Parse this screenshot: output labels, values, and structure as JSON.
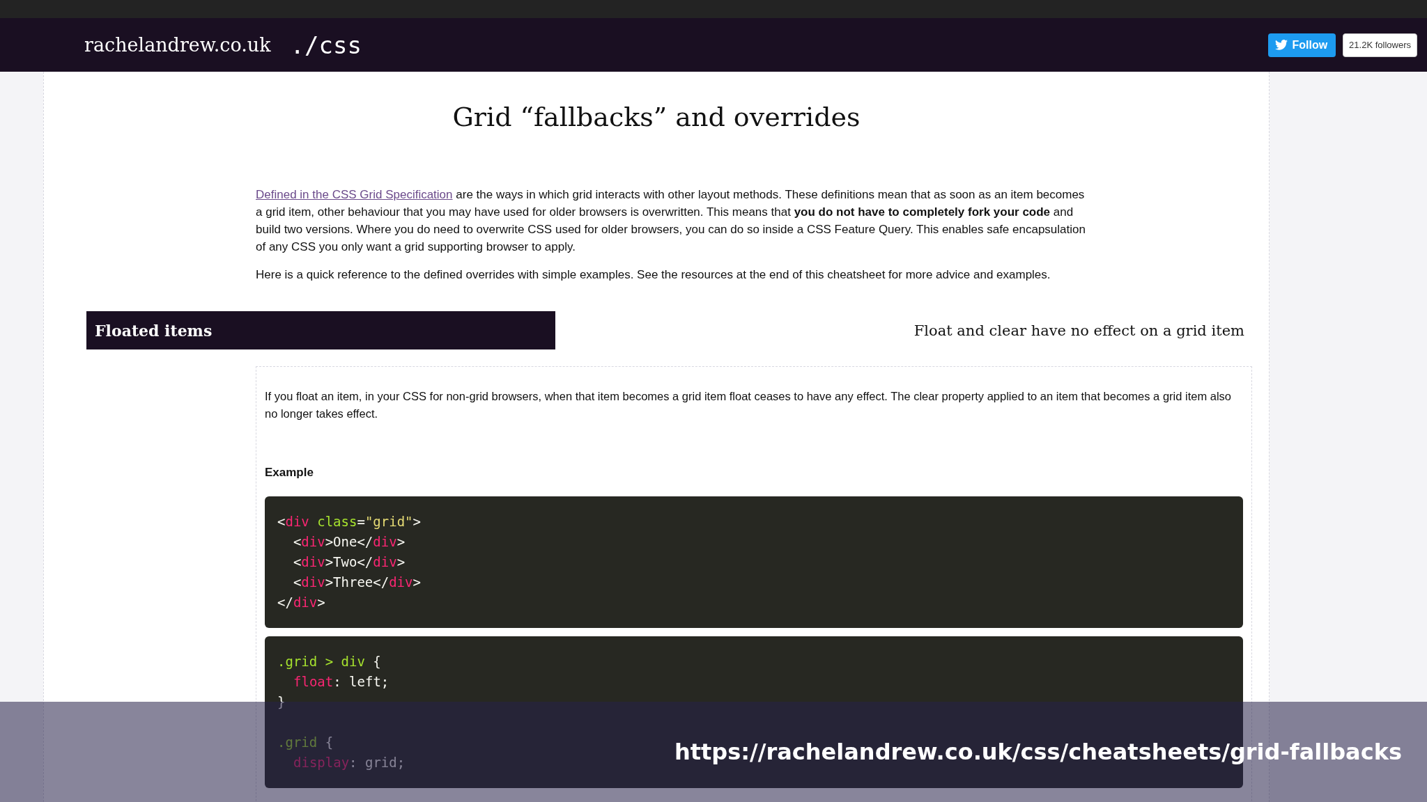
{
  "header": {
    "site_name": "rachelandrew.co.uk",
    "section": "./css",
    "follow_button": "Follow",
    "followers": "21.2K followers"
  },
  "page_title": "Grid “fallbacks” and overrides",
  "intro": [
    {
      "link": "Defined in the CSS Grid Specification",
      "text": " are the ways in which grid interacts with other layout methods. These definitions mean that as soon as an item becomes a grid item, other behaviour that you may have used for older browsers is overwritten. This means that **you do not have to completely fork your code** and build two versions. Where you do need to overwrite CSS used for older browsers, you can do so inside a CSS Feature Query. This enables safe encapsulation of any CSS you only want a grid supporting browser to apply."
    },
    {
      "text": "Here is a quick reference to the defined overrides with simple examples. See the resources at the end of this cheatsheet for more advice and examples."
    }
  ],
  "section": {
    "heading": "Floated items",
    "summary": "Float and clear have no effect on a grid item",
    "description": "If you float an item, in your CSS for non-grid browsers, when that item becomes a grid item float ceases to have any effect. The clear property applied to an item that becomes a grid item also no longer takes effect.",
    "example_label": "Example",
    "code_blocks": [
      {
        "lines": [
          {
            "tokens": [
              {
                "kind": "plain",
                "text": "<"
              },
              {
                "kind": "tag",
                "text": "div"
              },
              {
                "kind": "attr",
                "text": " class"
              },
              {
                "kind": "plain",
                "text": "="
              },
              {
                "kind": "string",
                "text": "\"grid\""
              },
              {
                "kind": "plain",
                "text": ">"
              }
            ]
          },
          {
            "tokens": [
              {
                "kind": "plain",
                "text": "  <"
              },
              {
                "kind": "tag",
                "text": "div"
              },
              {
                "kind": "plain",
                "text": ">One</"
              },
              {
                "kind": "tag",
                "text": "div"
              },
              {
                "kind": "plain",
                "text": ">"
              }
            ]
          },
          {
            "tokens": [
              {
                "kind": "plain",
                "text": "  <"
              },
              {
                "kind": "tag",
                "text": "div"
              },
              {
                "kind": "plain",
                "text": ">Two</"
              },
              {
                "kind": "tag",
                "text": "div"
              },
              {
                "kind": "plain",
                "text": ">"
              }
            ]
          },
          {
            "tokens": [
              {
                "kind": "plain",
                "text": "  <"
              },
              {
                "kind": "tag",
                "text": "div"
              },
              {
                "kind": "plain",
                "text": ">Three</"
              },
              {
                "kind": "tag",
                "text": "div"
              },
              {
                "kind": "plain",
                "text": ">"
              }
            ]
          },
          {
            "tokens": [
              {
                "kind": "plain",
                "text": "</"
              },
              {
                "kind": "tag",
                "text": "div"
              },
              {
                "kind": "plain",
                "text": ">"
              }
            ]
          }
        ]
      },
      {
        "lines": [
          {
            "tokens": [
              {
                "kind": "attr",
                "text": ".grid > div"
              },
              {
                "kind": "plain",
                "text": " {"
              }
            ]
          },
          {
            "indented": true,
            "tokens": [
              {
                "kind": "tag",
                "text": "float"
              },
              {
                "kind": "plain",
                "text": ": left;"
              }
            ]
          },
          {
            "tokens": [
              {
                "kind": "plain",
                "text": "}"
              }
            ]
          },
          {
            "space_before": true,
            "tokens": [
              {
                "kind": "attr",
                "text": ".grid"
              },
              {
                "kind": "plain",
                "text": " {"
              }
            ]
          },
          {
            "indented": true,
            "tokens": [
              {
                "kind": "tag",
                "text": "display"
              },
              {
                "kind": "plain",
                "text": ": grid;"
              }
            ]
          }
        ]
      }
    ]
  },
  "caption": {
    "url": "https://rachelandrew.co.uk/css/cheatsheets/grid-fallbacks"
  }
}
